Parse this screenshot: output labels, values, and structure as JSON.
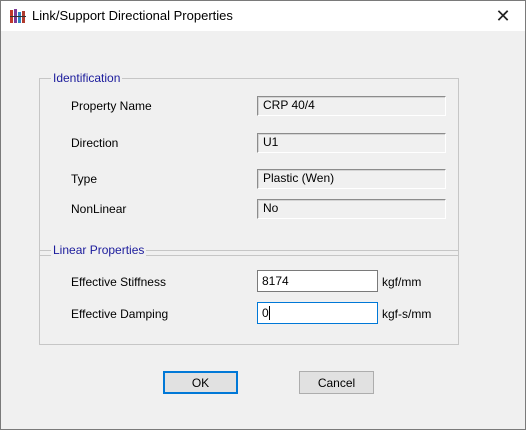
{
  "window": {
    "title": "Link/Support Directional Properties",
    "icon": "app-icon",
    "close_symbol": "✕"
  },
  "identification": {
    "group_label": "Identification",
    "rows": [
      {
        "label": "Property Name",
        "value": "CRP 40/4"
      },
      {
        "label": "Direction",
        "value": "U1"
      },
      {
        "label": "Type",
        "value": "Plastic (Wen)"
      },
      {
        "label": "NonLinear",
        "value": "No"
      }
    ]
  },
  "linear_properties": {
    "group_label": "Linear Properties",
    "stiffness": {
      "label": "Effective Stiffness",
      "value": "8174",
      "unit": "kgf/mm"
    },
    "damping": {
      "label": "Effective Damping",
      "value": "0",
      "unit": "kgf-s/mm"
    }
  },
  "buttons": {
    "ok": "OK",
    "cancel": "Cancel"
  },
  "colors": {
    "group_label": "#1b1b9c",
    "focus": "#0078d7"
  }
}
